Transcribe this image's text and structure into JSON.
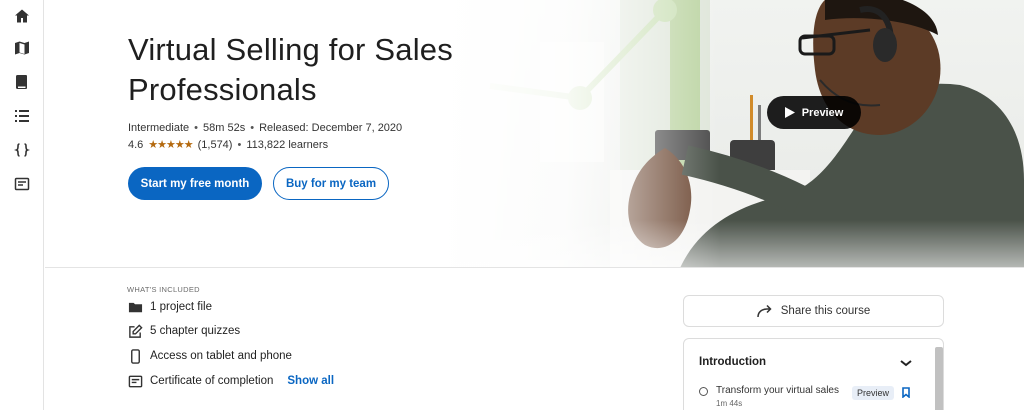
{
  "sidebar": {
    "items": [
      {
        "icon": "home-icon"
      },
      {
        "icon": "map-icon"
      },
      {
        "icon": "book-icon"
      },
      {
        "icon": "list-icon"
      },
      {
        "icon": "code-braces-icon"
      },
      {
        "icon": "certificate-icon"
      }
    ]
  },
  "course": {
    "title": "Virtual Selling for Sales Professionals",
    "level": "Intermediate",
    "duration": "58m 52s",
    "released": "Released: December 7, 2020",
    "rating": "4.6",
    "stars": "★★★★★",
    "rating_count": "(1,574)",
    "learners": "113,822 learners"
  },
  "actions": {
    "primary_label": "Start my free month",
    "secondary_label": "Buy for my team",
    "preview_label": "Preview"
  },
  "included": {
    "heading": "WHAT'S INCLUDED",
    "items": [
      {
        "label": "1 project file",
        "icon": "folder-icon"
      },
      {
        "label": "5 chapter quizzes",
        "icon": "edit-icon"
      },
      {
        "label": "Access on tablet and phone",
        "icon": "phone-icon"
      },
      {
        "label": "Certificate of completion",
        "icon": "certificate-icon"
      }
    ],
    "show_all_label": "Show all"
  },
  "share": {
    "label": "Share this course"
  },
  "toc": {
    "section_title": "Introduction",
    "lessons": [
      {
        "title": "Transform your virtual sales",
        "duration": "1m 44s",
        "badge": "Preview"
      }
    ]
  },
  "colors": {
    "accent": "#0a66c2",
    "star": "#b4690e",
    "chart_green": "#c9dfb4"
  }
}
